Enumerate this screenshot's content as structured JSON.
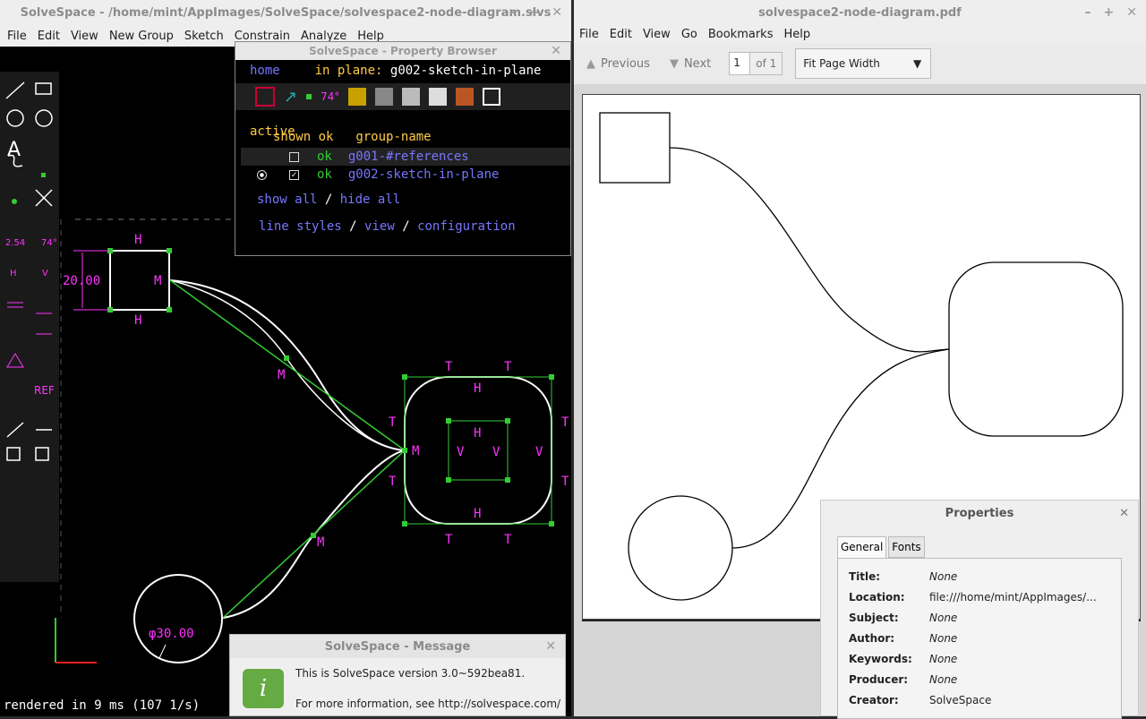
{
  "left_window": {
    "title": "SolveSpace - /home/mint/AppImages/SolveSpace/solvespace2-node-diagram.slvs",
    "menu": [
      "File",
      "Edit",
      "View",
      "New Group",
      "Sketch",
      "Constrain",
      "Analyze",
      "Help"
    ],
    "status": "rendered in 9 ms (107 1/s)"
  },
  "canvas_labels": {
    "dim_width": "20.00",
    "dim_dia": "φ30.00"
  },
  "property_browser": {
    "title": "SolveSpace - Property Browser",
    "home": "home",
    "in_plane_label": "in plane:",
    "in_plane_value": "g002-sketch-in-plane",
    "active": "active",
    "col_shown": "shown",
    "col_ok": "ok",
    "col_name": "group-name",
    "groups": [
      {
        "ok": "ok",
        "name": "g001-#references"
      },
      {
        "ok": "ok",
        "name": "g002-sketch-in-plane"
      }
    ],
    "show_all": "show all",
    "hide_all": "hide all",
    "slash": "/",
    "line_styles": "line styles",
    "view": "view",
    "configuration": "configuration"
  },
  "message": {
    "title": "SolveSpace - Message",
    "line1": "This is SolveSpace version 3.0~592bea81.",
    "line2": "For more information, see http://solvespace.com/"
  },
  "pdf_window": {
    "title": "solvespace2-node-diagram.pdf",
    "menu": [
      "File",
      "Edit",
      "View",
      "Go",
      "Bookmarks",
      "Help"
    ],
    "previous": "Previous",
    "next": "Next",
    "page_value": "1",
    "page_of": "of 1",
    "zoom": "Fit Page Width"
  },
  "properties": {
    "title": "Properties",
    "tabs": [
      "General",
      "Fonts"
    ],
    "rows": [
      {
        "k": "Title:",
        "v": "None"
      },
      {
        "k": "Location:",
        "v": "file:///home/mint/AppImages/..."
      },
      {
        "k": "Subject:",
        "v": "None"
      },
      {
        "k": "Author:",
        "v": "None"
      },
      {
        "k": "Keywords:",
        "v": "None"
      },
      {
        "k": "Producer:",
        "v": "None"
      },
      {
        "k": "Creator:",
        "v": "SolveSpace"
      }
    ]
  },
  "toolbar_icons": {
    "t1": "2.54",
    "t2": "74°",
    "ref": "REF"
  },
  "colors": {
    "accent_magenta": "#ff33ff",
    "green": "#33cc33",
    "amber": "#ffcc44",
    "blue_link": "#7777ff"
  }
}
